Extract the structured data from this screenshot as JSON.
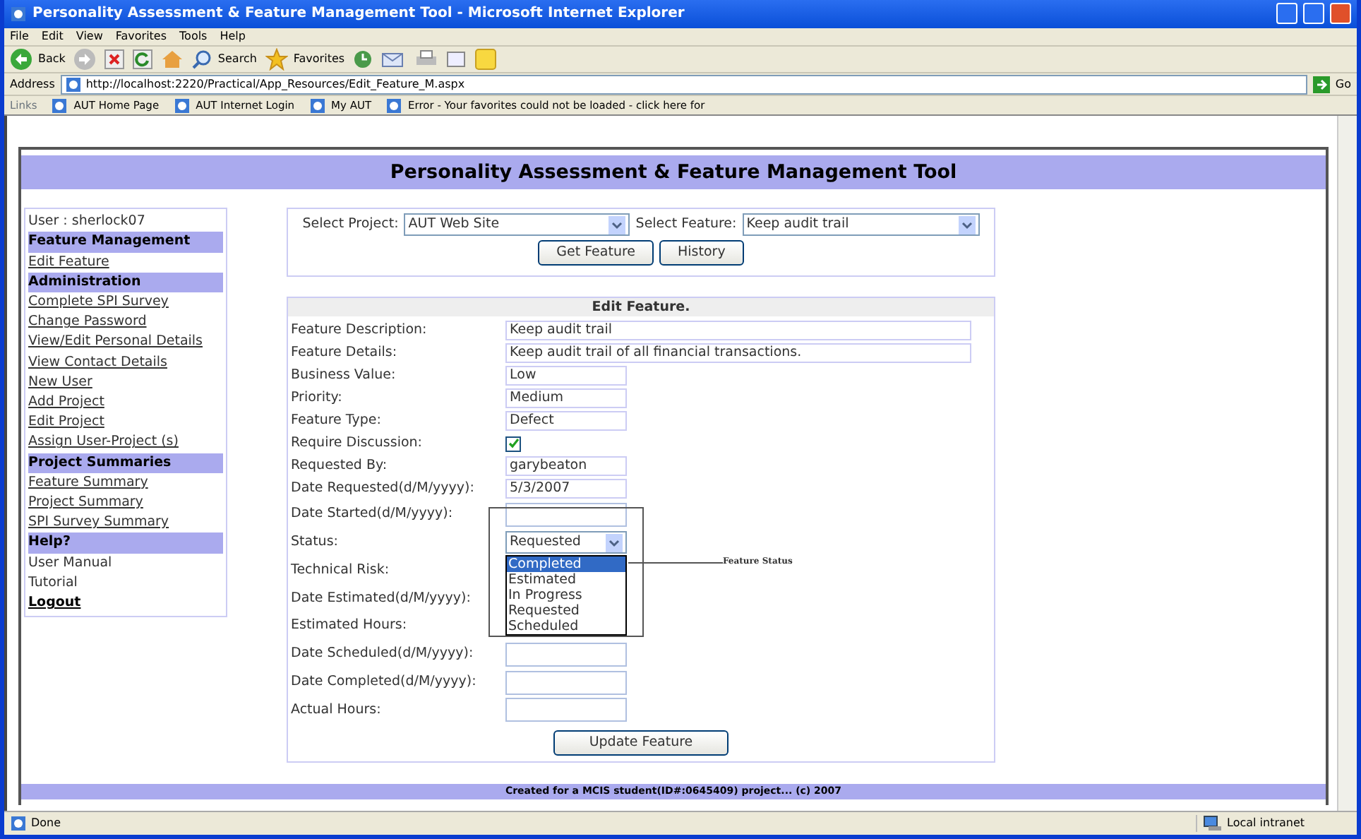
{
  "window": {
    "title": "Personality Assessment & Feature Management Tool - Microsoft Internet Explorer"
  },
  "menu": [
    "File",
    "Edit",
    "View",
    "Favorites",
    "Tools",
    "Help"
  ],
  "toolbar": {
    "back": "Back",
    "search": "Search",
    "favorites": "Favorites"
  },
  "address": {
    "label": "Address",
    "url": "http://localhost:2220/Practical/App_Resources/Edit_Feature_M.aspx",
    "go": "Go"
  },
  "links": {
    "label": "Links",
    "items": [
      "AUT Home Page",
      "AUT Internet Login",
      "My AUT",
      "Error - Your favorites could not be loaded - click here for"
    ]
  },
  "page_header": "Personality Assessment & Feature Management Tool",
  "sidebar": {
    "items": [
      {
        "kind": "text",
        "label": "User : sherlock07"
      },
      {
        "kind": "header",
        "label": "Feature Management"
      },
      {
        "kind": "link",
        "label": "Edit Feature"
      },
      {
        "kind": "header",
        "label": "Administration"
      },
      {
        "kind": "link",
        "label": "Complete SPI Survey"
      },
      {
        "kind": "link",
        "label": "Change Password"
      },
      {
        "kind": "link",
        "label": "View/Edit Personal Details"
      },
      {
        "kind": "link",
        "label": "View Contact Details"
      },
      {
        "kind": "link",
        "label": "New User"
      },
      {
        "kind": "link",
        "label": "Add Project"
      },
      {
        "kind": "link",
        "label": "Edit Project"
      },
      {
        "kind": "link",
        "label": "Assign User-Project (s)"
      },
      {
        "kind": "header",
        "label": "Project Summaries"
      },
      {
        "kind": "link",
        "label": "Feature Summary"
      },
      {
        "kind": "link",
        "label": "Project Summary"
      },
      {
        "kind": "link",
        "label": "SPI Survey Summary"
      },
      {
        "kind": "header",
        "label": "Help?"
      },
      {
        "kind": "plain",
        "label": "User Manual"
      },
      {
        "kind": "plain",
        "label": "Tutorial"
      },
      {
        "kind": "bold",
        "label": "Logout"
      }
    ]
  },
  "selectors": [
    {
      "label": "Select Project:",
      "value": "AUT Web Site"
    },
    {
      "label": "Select Feature:",
      "value": "Keep audit trail"
    }
  ],
  "selector_buttons": [
    "Get Feature",
    "History"
  ],
  "form": {
    "title": "Edit Feature.",
    "fields": [
      {
        "kind": "long-text",
        "label": "Feature Description:",
        "value": "Keep audit trail"
      },
      {
        "kind": "long-text",
        "label": "Feature Details:",
        "value": "Keep audit trail of all financial transactions."
      },
      {
        "kind": "text",
        "label": "Business Value:",
        "value": "Low"
      },
      {
        "kind": "text",
        "label": "Priority:",
        "value": "Medium"
      },
      {
        "kind": "text",
        "label": "Feature Type:",
        "value": "Defect"
      },
      {
        "kind": "checkbox",
        "label": "Require Discussion:",
        "checked": true
      },
      {
        "kind": "text",
        "label": "Requested By:",
        "value": "garybeaton"
      },
      {
        "kind": "text",
        "label": "Date Requested(d/M/yyyy):",
        "value": "5/3/2007"
      },
      {
        "kind": "text",
        "label": "Date Started(d/M/yyyy):"
      },
      {
        "kind": "select",
        "label": "Status:",
        "value": "Requested",
        "options": [
          {
            "label": "Completed",
            "highlighted": true
          },
          {
            "label": "Estimated",
            "highlighted": false
          },
          {
            "label": "In Progress",
            "highlighted": false
          },
          {
            "label": "Requested",
            "highlighted": false
          },
          {
            "label": "Scheduled",
            "highlighted": false
          }
        ]
      },
      {
        "kind": "label",
        "label": "Technical Risk:"
      },
      {
        "kind": "label",
        "label": "Date Estimated(d/M/yyyy):"
      },
      {
        "kind": "label",
        "label": "Estimated Hours:"
      },
      {
        "kind": "text",
        "label": "Date Scheduled(d/M/yyyy):"
      },
      {
        "kind": "text",
        "label": "Date Completed(d/M/yyyy):"
      },
      {
        "kind": "text",
        "label": "Actual Hours:"
      }
    ],
    "submit": "Update Feature"
  },
  "annotation": "Feature Status",
  "footer": "Created for a MCIS student(ID#:0645409) project... (c) 2007",
  "status_bar": {
    "text": "Done",
    "zone": "Local intranet"
  }
}
